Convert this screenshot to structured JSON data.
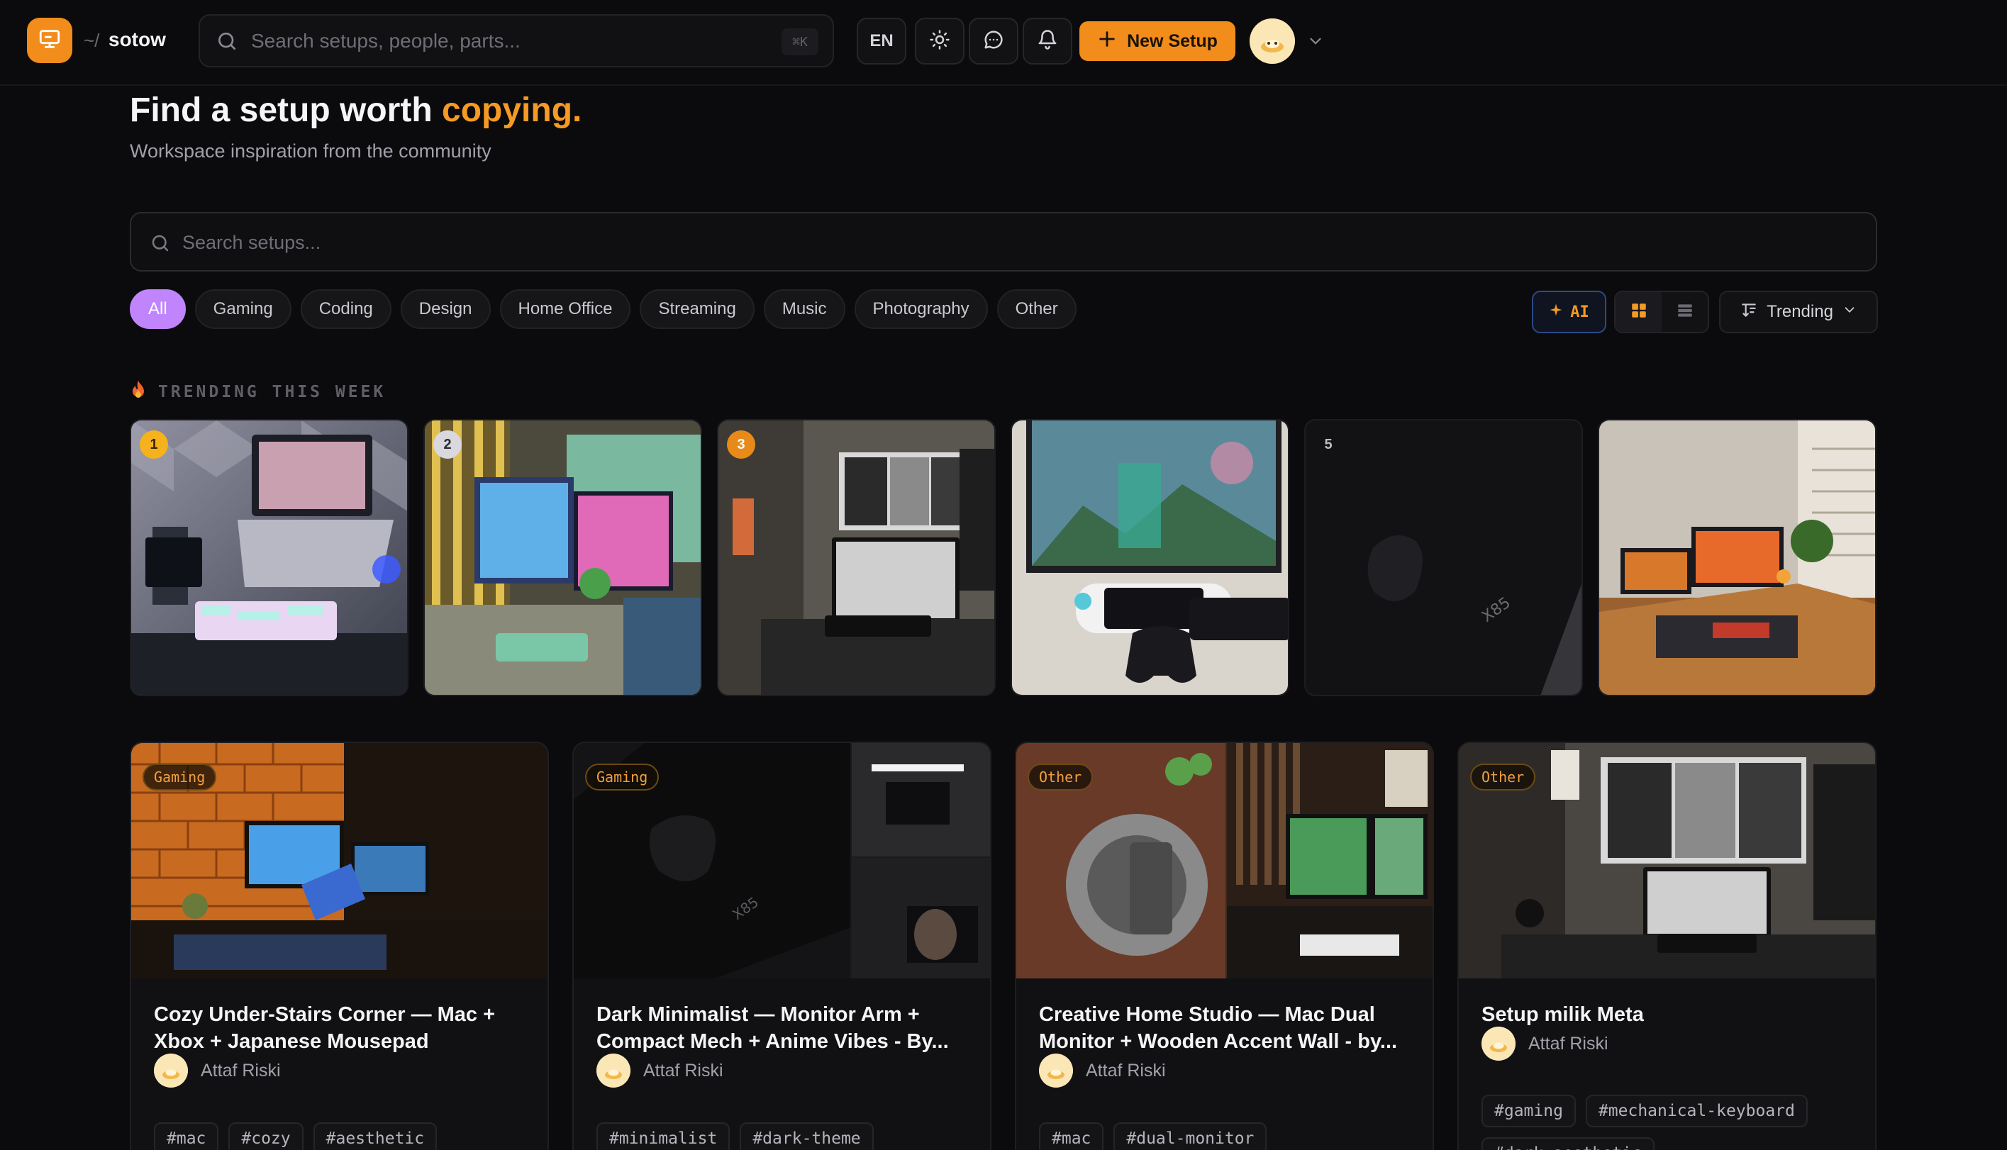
{
  "brand": {
    "prefix": "~/",
    "name": "sotow"
  },
  "topbar": {
    "search_placeholder": "Search setups, people, parts...",
    "search_shortcut": "⌘K",
    "lang": "EN",
    "new_setup_label": "New Setup"
  },
  "hero": {
    "title_main": "Find a setup worth ",
    "title_accent": "copying.",
    "subtitle": "Workspace inspiration from the community",
    "search_placeholder": "Search setups..."
  },
  "filters": {
    "chips": [
      "All",
      "Gaming",
      "Coding",
      "Design",
      "Home Office",
      "Streaming",
      "Music",
      "Photography",
      "Other"
    ],
    "active": "All",
    "ai_label": "AI",
    "sort_label": "Trending"
  },
  "trending": {
    "label": "TRENDING THIS WEEK",
    "ranks": [
      "1",
      "2",
      "3",
      "",
      "5",
      ""
    ]
  },
  "feed": [
    {
      "category": "Gaming",
      "title": "Cozy Under-Stairs Corner — Mac + Xbox + Japanese Mousepad",
      "author": "Attaf Riski",
      "tags": [
        "#mac",
        "#cozy",
        "#aesthetic"
      ]
    },
    {
      "category": "Gaming",
      "title": "Dark Minimalist — Monitor Arm + Compact Mech + Anime Vibes - By...",
      "author": "Attaf Riski",
      "tags": [
        "#minimalist",
        "#dark-theme"
      ]
    },
    {
      "category": "Other",
      "title": "Creative Home Studio — Mac Dual Monitor + Wooden Accent Wall - by...",
      "author": "Attaf Riski",
      "tags": [
        "#mac",
        "#dual-monitor"
      ]
    },
    {
      "category": "Other",
      "title": "Setup milik Meta",
      "author": "Attaf Riski",
      "tags": [
        "#gaming",
        "#mechanical-keyboard",
        "#dark-aesthetic"
      ]
    }
  ],
  "colors": {
    "accent": "#f59a24",
    "brand_tile": "#f28c1b",
    "active_chip": "#c084fc",
    "background": "#0b0b0d"
  },
  "icons": {
    "logo": "monitor-icon",
    "search": "search-icon",
    "theme": "sun-icon",
    "messages": "chat-icon",
    "notifications": "bell-icon",
    "add": "plus-icon",
    "menu": "chevron-down-icon",
    "ai": "sparkle-icon",
    "grid": "grid-icon",
    "list": "list-icon",
    "sort": "sort-icon",
    "trending": "flame-icon"
  }
}
